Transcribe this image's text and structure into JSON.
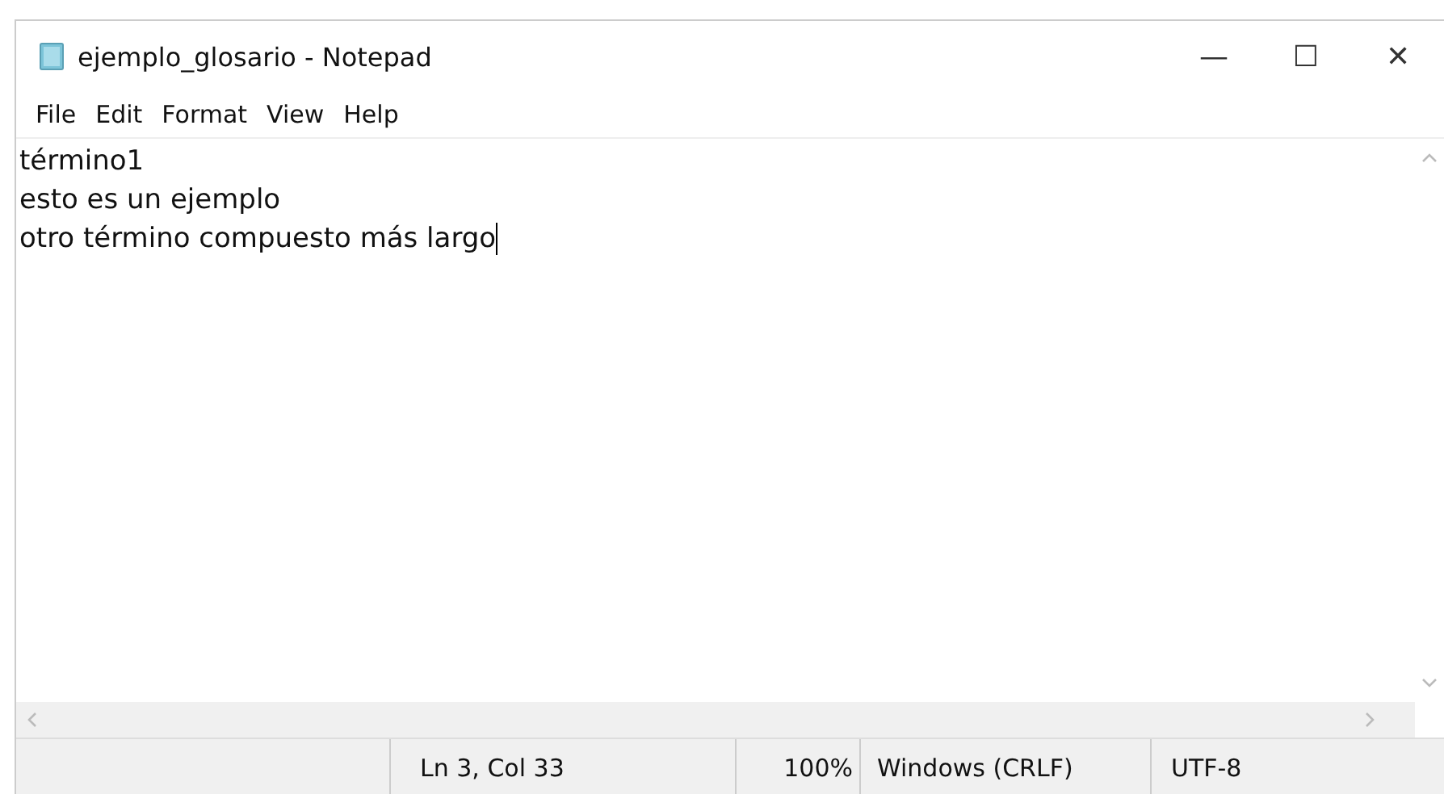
{
  "window": {
    "title": "ejemplo_glosario - Notepad",
    "controls": [
      "—",
      "☐",
      "✕"
    ]
  },
  "menu": [
    "File",
    "Edit",
    "Format",
    "View",
    "Help"
  ],
  "editor": {
    "lines": [
      "término1",
      "esto es un ejemplo",
      "otro término compuesto más largo"
    ]
  },
  "status_bar": {
    "position": "Ln 3, Col 33",
    "zoom": "100%",
    "line_ending": "Windows (CRLF)",
    "encoding": "UTF-8"
  }
}
